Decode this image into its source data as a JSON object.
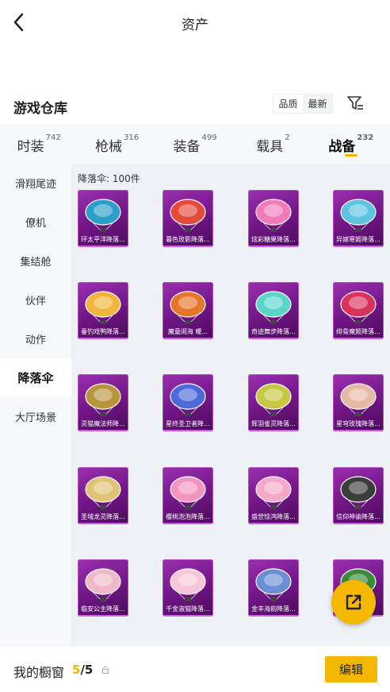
{
  "header": {
    "title": "资产"
  },
  "section": {
    "title": "游戏仓库",
    "sort_quality": "品质",
    "sort_latest": "最新"
  },
  "tabs": [
    {
      "label": "时装",
      "count": "742"
    },
    {
      "label": "枪械",
      "count": "316"
    },
    {
      "label": "装备",
      "count": "499"
    },
    {
      "label": "载具",
      "count": "2"
    },
    {
      "label": "战备",
      "count": "232"
    }
  ],
  "side_menu": [
    "滑翔尾迹",
    "僚机",
    "集结舱",
    "伙伴",
    "动作",
    "降落伞",
    "大厅场景"
  ],
  "grid": {
    "count_label": "降落伞: 100件",
    "items": [
      {
        "name": "环太平洋降落...",
        "icon": "parachute-icon",
        "color": "#2a9fc9"
      },
      {
        "name": "暮色玫影降落...",
        "icon": "parachute-icon",
        "color": "#e44b3a"
      },
      {
        "name": "炫彩糖果降落...",
        "icon": "parachute-icon",
        "color": "#f07bb8"
      },
      {
        "name": "异嫁寒姬降落...",
        "icon": "parachute-icon",
        "color": "#5ec3e0"
      },
      {
        "name": "垂钓戏鸭降落...",
        "icon": "parachute-icon",
        "color": "#f2b43a"
      },
      {
        "name": "魔童闹海 暖...",
        "icon": "parachute-icon",
        "color": "#e6762a"
      },
      {
        "name": "奇迹舞步降落...",
        "icon": "parachute-icon",
        "color": "#59d6c9"
      },
      {
        "name": "绯骨魔姬降落...",
        "icon": "parachute-icon",
        "color": "#d9325b"
      },
      {
        "name": "灵猫魔法师降...",
        "icon": "parachute-icon",
        "color": "#b8953c"
      },
      {
        "name": "星终圣卫者降...",
        "icon": "parachute-icon",
        "color": "#4c6ad9"
      },
      {
        "name": "辉羽雀灵降落...",
        "icon": "parachute-icon",
        "color": "#c7c743"
      },
      {
        "name": "星穹玫瑰降落...",
        "icon": "parachute-icon",
        "color": "#e7b8a3"
      },
      {
        "name": "圣域龙灵降落...",
        "icon": "parachute-icon",
        "color": "#e1c277"
      },
      {
        "name": "樱桃泡泡降落...",
        "icon": "parachute-icon",
        "color": "#f296c1"
      },
      {
        "name": "盛世惊鸿降落...",
        "icon": "parachute-icon",
        "color": "#f5a8c8"
      },
      {
        "name": "信仰神谕降落...",
        "icon": "parachute-icon",
        "color": "#3c3c3c"
      },
      {
        "name": "临安公主降落...",
        "icon": "parachute-icon",
        "color": "#f0b9c8"
      },
      {
        "name": "千金淑猫降落...",
        "icon": "parachute-icon",
        "color": "#f7c6d8"
      },
      {
        "name": "金丰海韵降落...",
        "icon": "parachute-icon",
        "color": "#6a8fd6"
      },
      {
        "name": "",
        "icon": "parachute-icon",
        "color": "#3d8a3a"
      }
    ]
  },
  "bottom": {
    "showcase_label": "我的橱窗",
    "current": "5",
    "separator": "/",
    "max": "5",
    "edit": "编辑"
  },
  "colors": {
    "accent": "#f5b800",
    "rarity": "#8a2a9c"
  }
}
